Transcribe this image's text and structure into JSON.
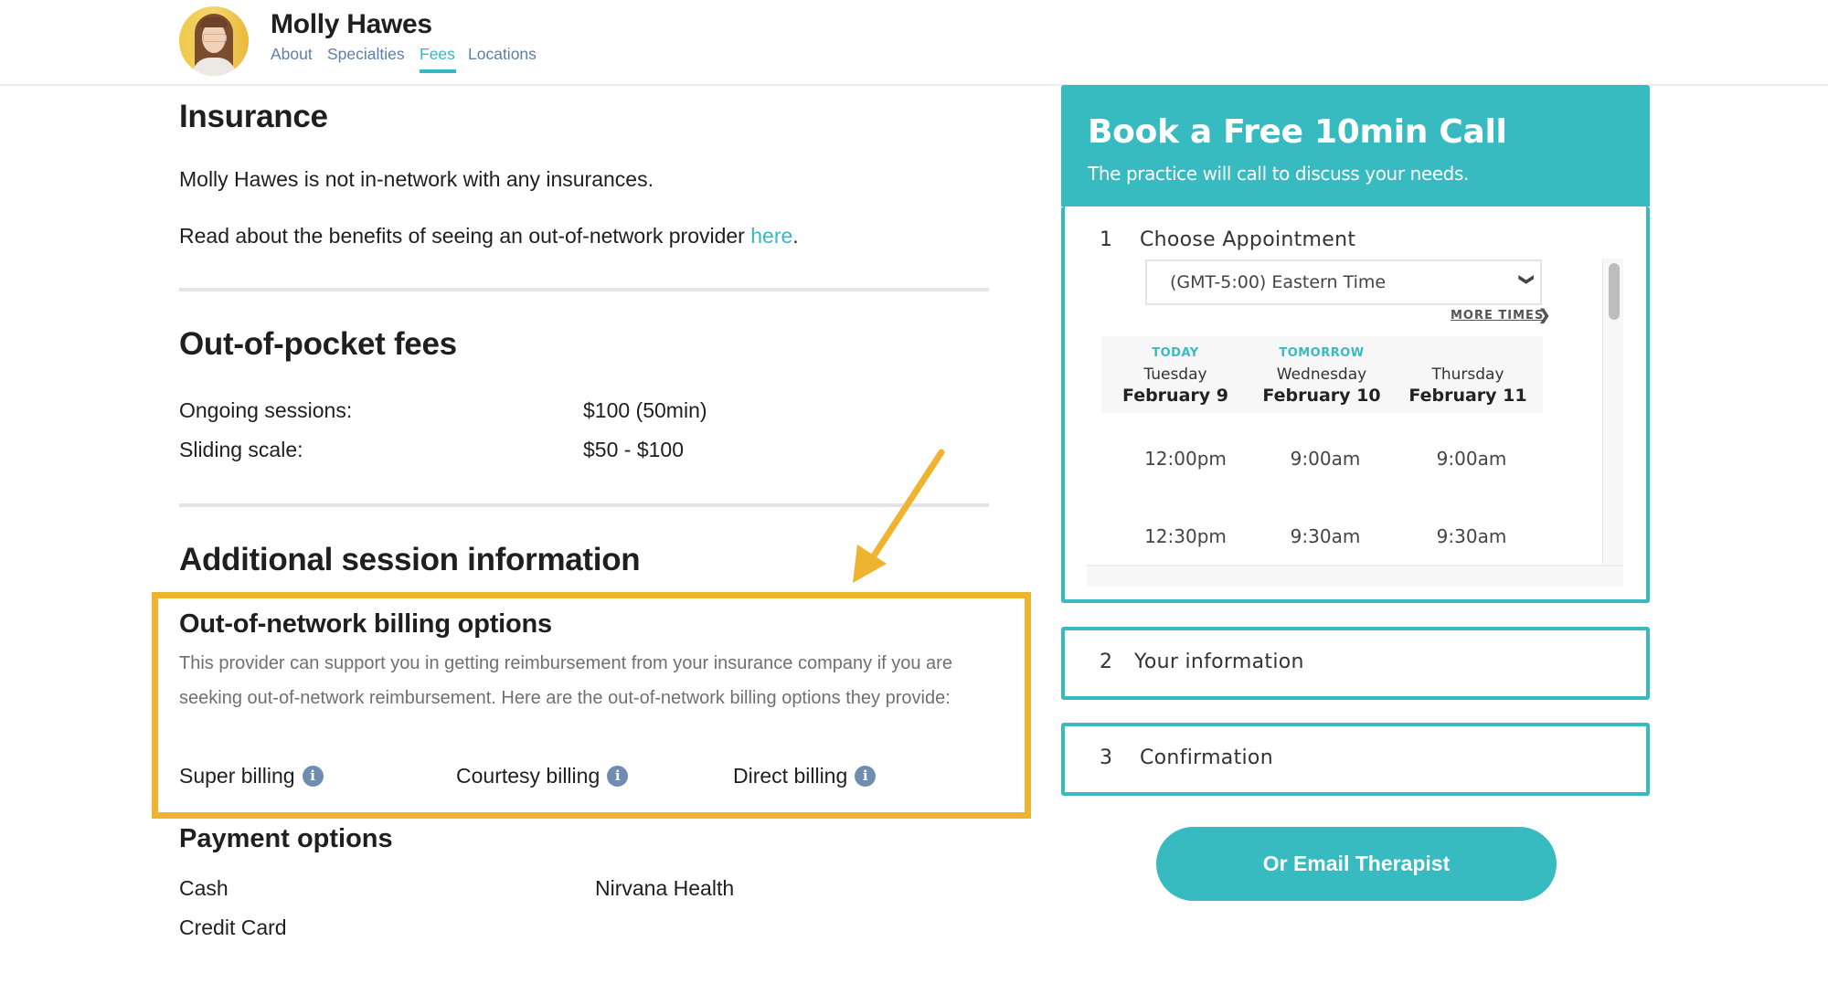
{
  "header": {
    "therapist_name": "Molly Hawes",
    "avatar_alt": "Molly Hawes profile photo",
    "nav": [
      {
        "label": "About",
        "active": false
      },
      {
        "label": "Specialties",
        "active": false
      },
      {
        "label": "Fees",
        "active": true
      },
      {
        "label": "Locations",
        "active": false
      }
    ]
  },
  "insurance": {
    "title": "Insurance",
    "statement": "Molly Hawes is not in-network with any insurances.",
    "benefits_prefix": "Read about the benefits of seeing an out-of-network provider ",
    "benefits_link": "here",
    "benefits_suffix": "."
  },
  "fees": {
    "title": "Out-of-pocket fees",
    "rows": [
      {
        "label": "Ongoing sessions:",
        "value": "$100 (50min)"
      },
      {
        "label": "Sliding scale:",
        "value": "$50 - $100"
      }
    ]
  },
  "additional": {
    "title": "Additional session information",
    "oon": {
      "title": "Out-of-network billing options",
      "description": "This provider can support you in getting reimbursement from your insurance company if you are seeking out-of-network reimbursement. Here are the out-of-network billing options they provide:",
      "options": [
        "Super billing",
        "Courtesy billing",
        "Direct billing"
      ],
      "info_icon_glyph": "i"
    },
    "payment": {
      "title": "Payment options",
      "items": [
        "Cash",
        "Credit Card",
        "Nirvana Health"
      ]
    }
  },
  "annotation": {
    "highlight_color": "#efb32f"
  },
  "booking": {
    "title": "Book a Free 10min Call",
    "subtitle": "The practice will call to discuss your needs.",
    "accent_color": "#37bbc1",
    "steps": [
      {
        "number": "1",
        "label": "Choose Appointment"
      },
      {
        "number": "2",
        "label": "Your information"
      },
      {
        "number": "3",
        "label": "Confirmation"
      }
    ],
    "timezone": {
      "selected": "(GMT-5:00) Eastern Time",
      "chevron": "❯"
    },
    "more_times": "MORE TIMES",
    "more_times_chevron": "❯",
    "days": [
      {
        "tag": "TODAY",
        "weekday": "Tuesday",
        "date": "February 9",
        "times": [
          "12:00pm",
          "12:30pm"
        ]
      },
      {
        "tag": "TOMORROW",
        "weekday": "Wednesday",
        "date": "February 10",
        "times": [
          "9:00am",
          "9:30am"
        ]
      },
      {
        "tag": "",
        "weekday": "Thursday",
        "date": "February 11",
        "times": [
          "9:00am",
          "9:30am"
        ]
      }
    ],
    "email_button": "Or Email Therapist"
  }
}
